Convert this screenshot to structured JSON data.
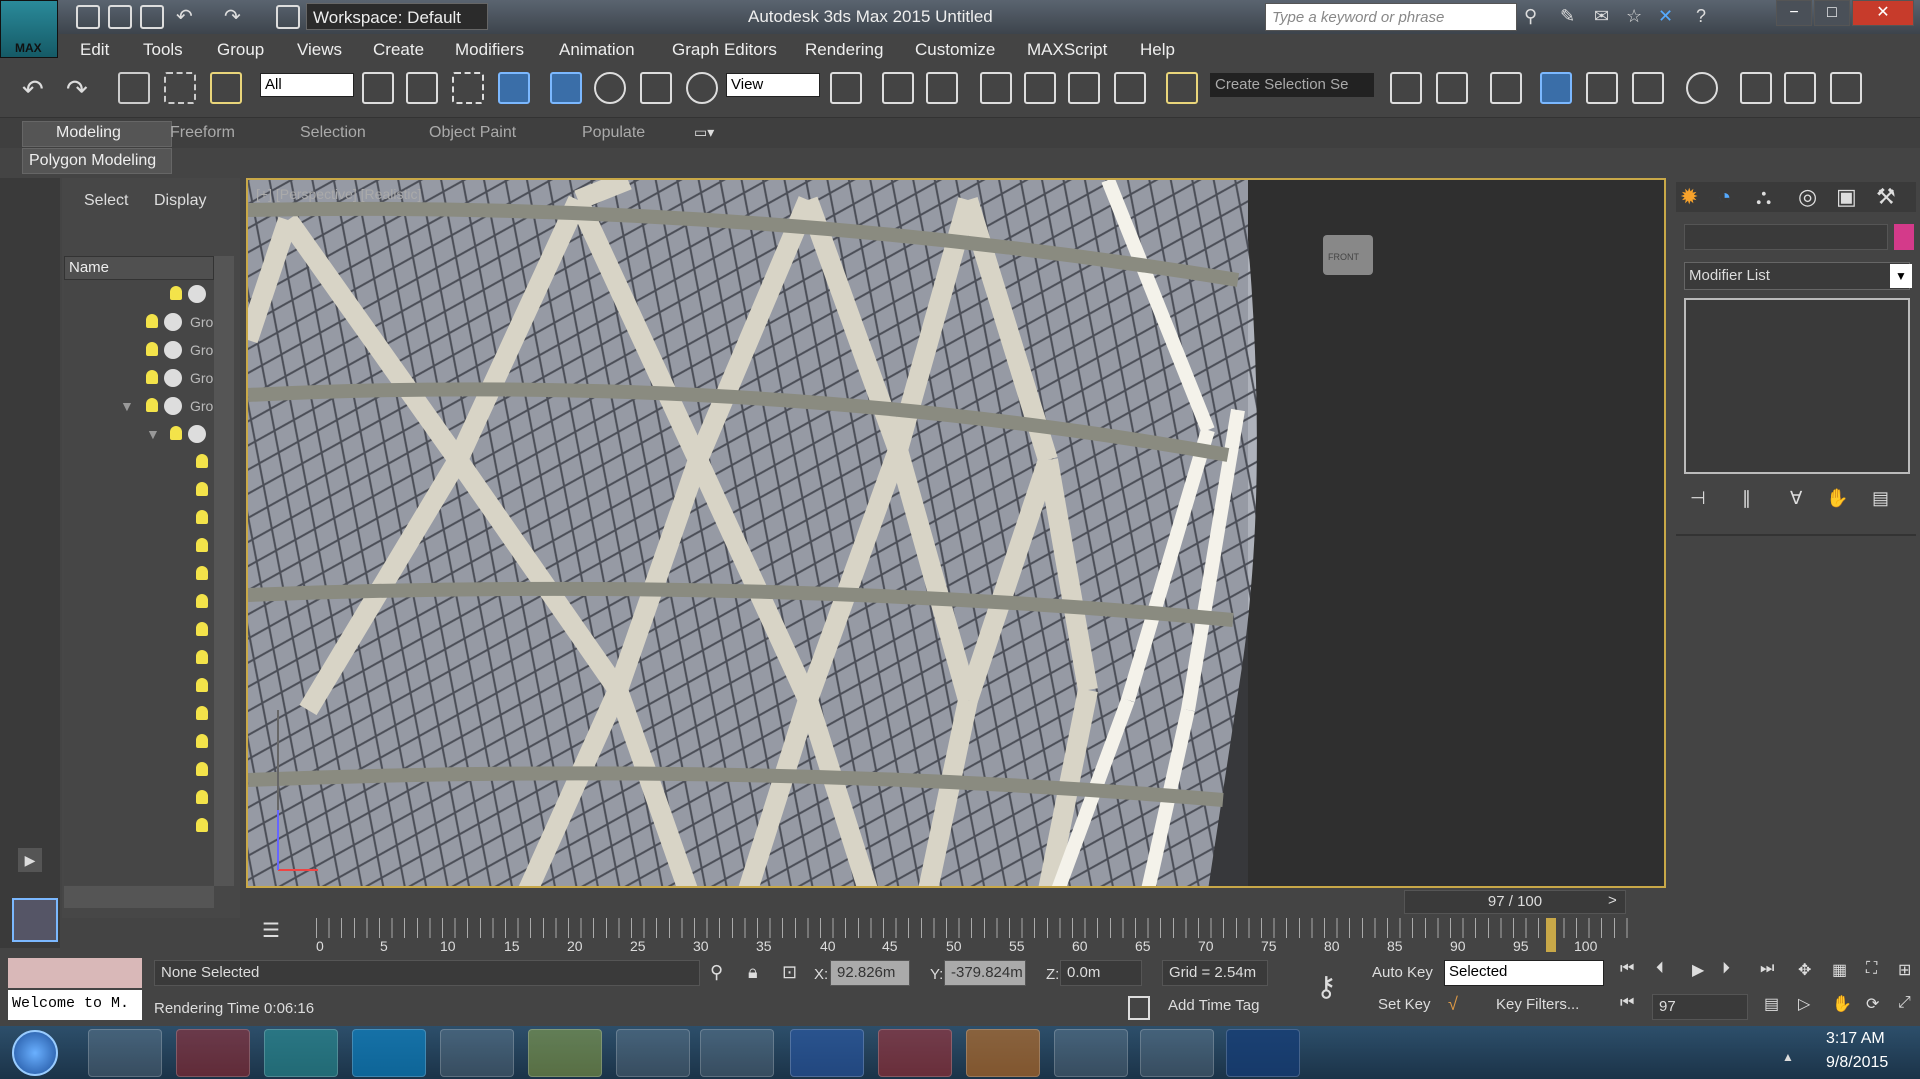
{
  "title_bar": {
    "logo_text": "MAX",
    "workspace": "Workspace: Default",
    "app_title": "Autodesk 3ds Max 2015    Untitled",
    "search_placeholder": "Type a keyword or phrase"
  },
  "menu": [
    "Edit",
    "Tools",
    "Group",
    "Views",
    "Create",
    "Modifiers",
    "Animation",
    "Graph Editors",
    "Rendering",
    "Customize",
    "MAXScript",
    "Help"
  ],
  "toolbar": {
    "filter": "All",
    "ref_coord": "View",
    "selection_set": "Create Selection Se"
  },
  "ribbon": {
    "tabs": [
      "Modeling",
      "Freeform",
      "Selection",
      "Object Paint",
      "Populate"
    ],
    "panel": "Polygon Modeling"
  },
  "scene_explorer": {
    "tabs": [
      "Select",
      "Display"
    ],
    "name_header": "Name",
    "row_label": "Gro"
  },
  "viewport": {
    "label": "[+] [Perspective] [Realistic]",
    "viewcube": "FRONT"
  },
  "command_panel": {
    "modifier_list": "Modifier List"
  },
  "timeline": {
    "frame": "97 / 100",
    "ticks": [
      "0",
      "5",
      "10",
      "15",
      "20",
      "25",
      "30",
      "35",
      "40",
      "45",
      "50",
      "55",
      "60",
      "65",
      "70",
      "75",
      "80",
      "85",
      "90",
      "95",
      "100"
    ]
  },
  "status": {
    "selection": "None Selected",
    "render_time": "Rendering Time  0:06:16",
    "listener": "Welcome to M.",
    "x_label": "X:",
    "x_val": "92.826m",
    "y_label": "Y:",
    "y_val": "-379.824m",
    "z_label": "Z:",
    "z_val": "0.0m",
    "grid": "Grid = 2.54m",
    "add_time_tag": "Add Time Tag",
    "auto_key": "Auto Key",
    "set_key": "Set Key",
    "key_mode": "Selected",
    "key_filters": "Key Filters...",
    "current_frame": "97"
  },
  "clock": {
    "time": "3:17 AM",
    "date": "9/8/2015"
  }
}
